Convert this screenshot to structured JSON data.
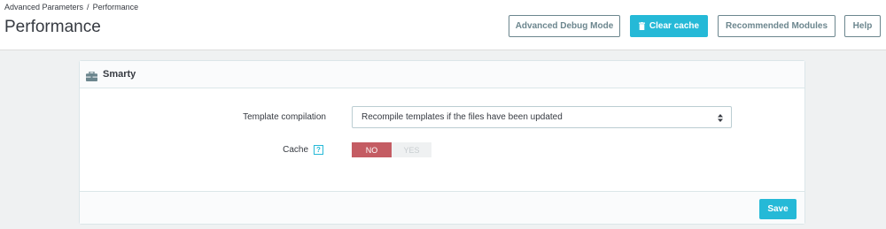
{
  "breadcrumb": {
    "parent": "Advanced Parameters",
    "separator": "/",
    "current": "Performance"
  },
  "page_title": "Performance",
  "toolbar": {
    "debug_mode": "Advanced Debug Mode",
    "clear_cache": "Clear cache",
    "recommended_modules": "Recommended Modules",
    "help": "Help"
  },
  "panel": {
    "title": "Smarty",
    "icon": "briefcase-icon",
    "template_compilation": {
      "label": "Template compilation",
      "value": "Recompile templates if the files have been updated"
    },
    "cache": {
      "label": "Cache",
      "help": "?",
      "options": [
        "NO",
        "YES"
      ],
      "selected": "NO"
    },
    "save_label": "Save"
  },
  "colors": {
    "accent": "#25b9d7",
    "no_active": "#c45c63",
    "outline": "#6c868e"
  }
}
